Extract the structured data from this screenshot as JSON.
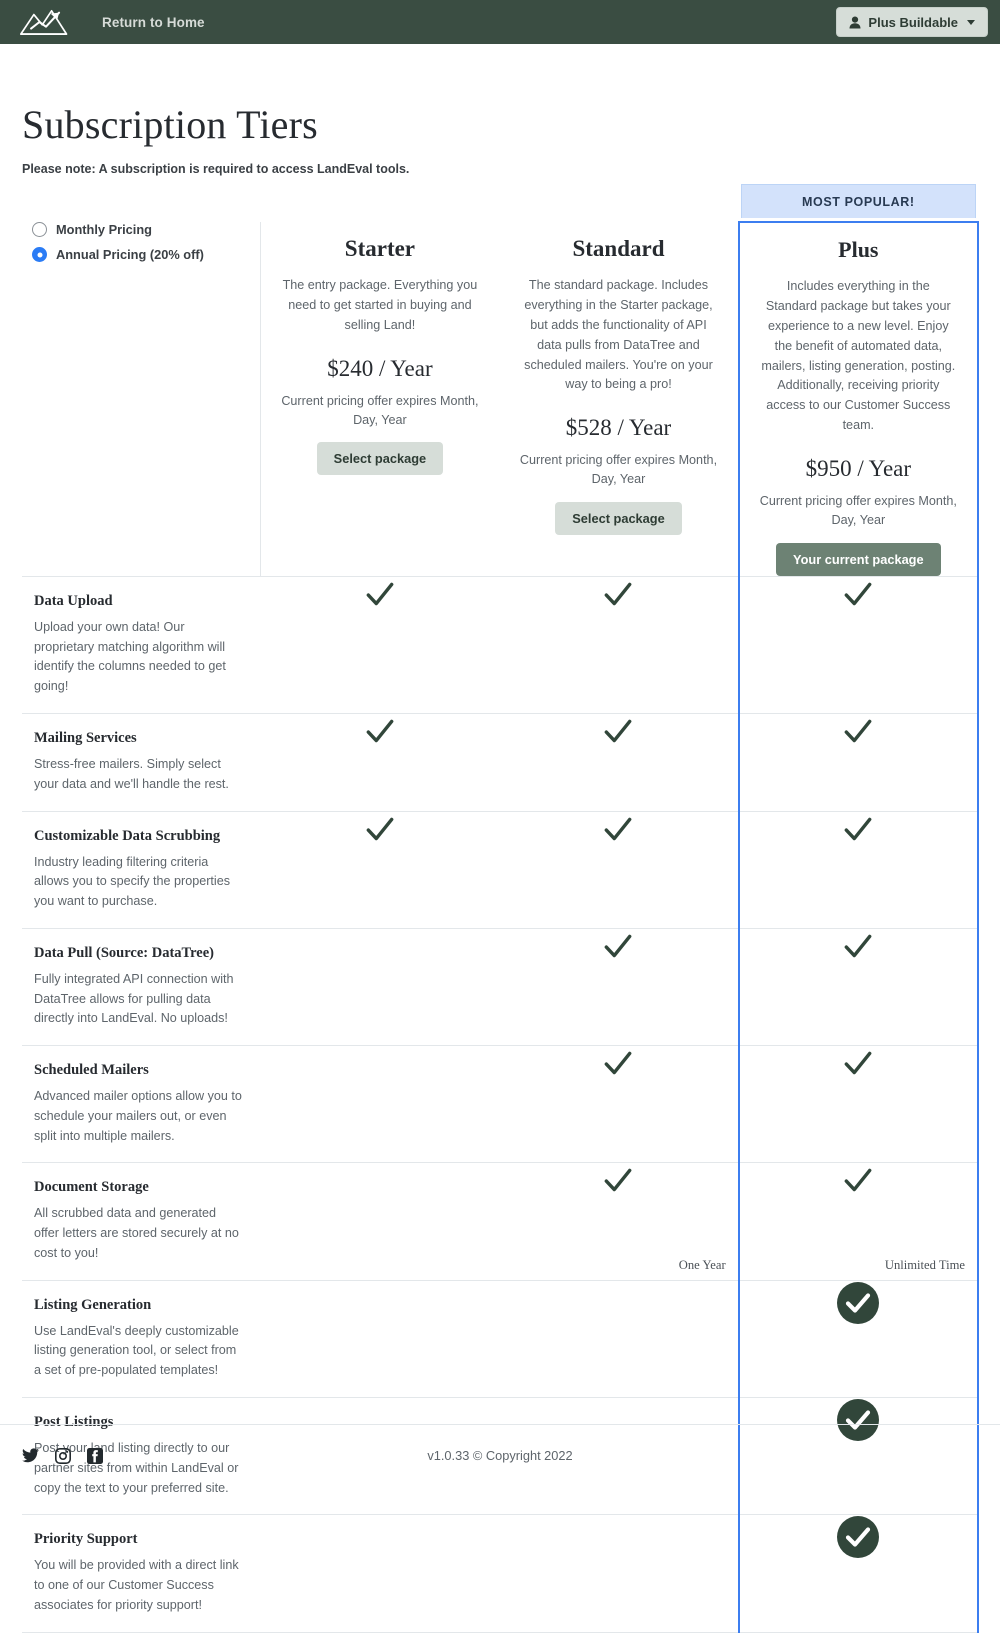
{
  "navbar": {
    "logo_icon": "mountain-chart-logo-icon",
    "home_link": "Return to Home",
    "account_icon": "user-icon",
    "account_label": "Plus Buildable",
    "caret_icon": "chevron-down-icon",
    "background_color": "#3a4d42"
  },
  "header": {
    "title": "Subscription Tiers",
    "note": "Please note: A subscription is required to access LandEval tools."
  },
  "pricing_toggle": {
    "options": [
      {
        "label": "Monthly Pricing",
        "selected": false
      },
      {
        "label": "Annual Pricing (20% off)",
        "selected": true
      }
    ],
    "selected_color": "#2b7cf5"
  },
  "popular_ribbon": {
    "label": "MOST POPULAR!",
    "background_color": "#d3e2fb",
    "text_color": "#283a52"
  },
  "packages": [
    {
      "name": "Starter",
      "description": "The entry package. Everything you need to get started in buying and selling Land!",
      "price": "$240 / Year",
      "expiry": "Current pricing offer expires Month, Day, Year",
      "button_label": "Select package",
      "button_state": "secondary",
      "highlighted": false
    },
    {
      "name": "Standard",
      "description": "The standard package. Includes everything in the Starter package, but adds the functionality of API data pulls from DataTree and scheduled mailers. You're on your way to being a pro!",
      "price": "$528 / Year",
      "expiry": "Current pricing offer expires Month, Day, Year",
      "button_label": "Select package",
      "button_state": "secondary",
      "highlighted": false
    },
    {
      "name": "Plus",
      "description": "Includes everything in the Standard package but takes your experience to a new level. Enjoy the benefit of automated data, mailers, listing generation, posting. Additionally, receiving priority access to our Customer Success team.",
      "price": "$950 / Year",
      "expiry": "Current pricing offer expires Month, Day, Year",
      "button_label": "Your current package",
      "button_state": "current",
      "highlighted": true
    }
  ],
  "features": [
    {
      "title": "Data Upload",
      "description": "Upload your own data! Our proprietary matching algorithm will identify the columns needed to get going!",
      "starter": "check",
      "standard": "check",
      "plus": "check",
      "starter_note": "",
      "standard_note": "",
      "plus_note": ""
    },
    {
      "title": "Mailing Services",
      "description": "Stress-free mailers. Simply select your data and we'll handle the rest.",
      "starter": "check",
      "standard": "check",
      "plus": "check",
      "starter_note": "",
      "standard_note": "",
      "plus_note": ""
    },
    {
      "title": "Customizable Data Scrubbing",
      "description": "Industry leading filtering criteria allows you to specify the properties you want to purchase.",
      "starter": "check",
      "standard": "check",
      "plus": "check",
      "starter_note": "",
      "standard_note": "",
      "plus_note": ""
    },
    {
      "title": "Data Pull (Source: DataTree)",
      "description": "Fully integrated API connection with DataTree allows for pulling data directly into LandEval. No uploads!",
      "starter": "none",
      "standard": "check",
      "plus": "check",
      "starter_note": "",
      "standard_note": "",
      "plus_note": ""
    },
    {
      "title": "Scheduled Mailers",
      "description": "Advanced mailer options allow you to schedule your mailers out, or even split into multiple mailers.",
      "starter": "none",
      "standard": "check",
      "plus": "check",
      "starter_note": "",
      "standard_note": "",
      "plus_note": ""
    },
    {
      "title": "Document Storage",
      "description": "All scrubbed data and generated offer letters are stored securely at no cost to you!",
      "starter": "none",
      "standard": "check",
      "plus": "check",
      "starter_note": "",
      "standard_note": "One Year",
      "plus_note": "Unlimited Time"
    },
    {
      "title": "Listing Generation",
      "description": "Use LandEval's deeply customizable listing generation tool, or select from a set of pre-populated templates!",
      "starter": "none",
      "standard": "none",
      "plus": "check-circle",
      "starter_note": "",
      "standard_note": "",
      "plus_note": ""
    },
    {
      "title": "Post Listings",
      "description": "Post your land listing directly to our partner sites from within LandEval or copy the text to your preferred site.",
      "starter": "none",
      "standard": "none",
      "plus": "check-circle",
      "starter_note": "",
      "standard_note": "",
      "plus_note": ""
    },
    {
      "title": "Priority Support",
      "description": "You will be provided with a direct link to one of our Customer Success associates for priority support!",
      "starter": "none",
      "standard": "none",
      "plus": "check-circle",
      "starter_note": "",
      "standard_note": "",
      "plus_note": ""
    }
  ],
  "footer": {
    "social_icons": [
      "twitter-icon",
      "instagram-icon",
      "facebook-icon"
    ],
    "copyright": "v1.0.33 © Copyright 2022"
  },
  "colors": {
    "brand_green": "#3a4d42",
    "check_green": "#31463a",
    "highlight_blue": "#3c7ef0",
    "ribbon_blue": "#d3e2fb"
  }
}
